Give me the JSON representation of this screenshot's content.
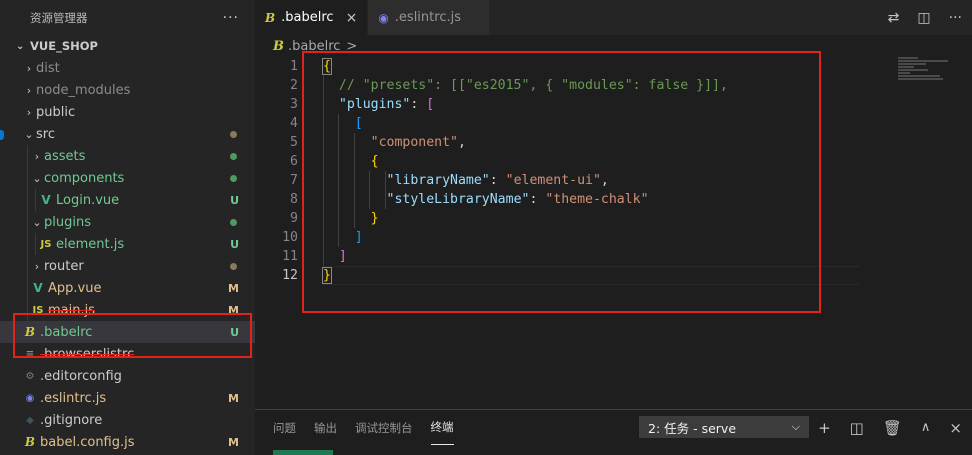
{
  "sidebar": {
    "title": "资源管理器",
    "more_icon": "ellipsis-icon",
    "project": "VUE_SHOP",
    "items": [
      {
        "label": "dist",
        "kind": "folder",
        "expanded": false,
        "depth": 1,
        "color": "#8c8c8c",
        "decoration": ""
      },
      {
        "label": "node_modules",
        "kind": "folder",
        "expanded": false,
        "depth": 1,
        "color": "#8c8c8c",
        "decoration": ""
      },
      {
        "label": "public",
        "kind": "folder",
        "expanded": false,
        "depth": 1,
        "color": "#cccccc",
        "decoration": ""
      },
      {
        "label": "src",
        "kind": "folder",
        "expanded": true,
        "depth": 1,
        "color": "#cccccc",
        "decoration": "dot-gray"
      },
      {
        "label": "assets",
        "kind": "folder",
        "expanded": false,
        "depth": 2,
        "color": "#73c991",
        "decoration": "dot-green"
      },
      {
        "label": "components",
        "kind": "folder",
        "expanded": true,
        "depth": 2,
        "color": "#73c991",
        "decoration": "dot-green"
      },
      {
        "label": "Login.vue",
        "kind": "vue",
        "depth": 3,
        "color": "#73c991",
        "decoration": "U"
      },
      {
        "label": "plugins",
        "kind": "folder",
        "expanded": true,
        "depth": 2,
        "color": "#73c991",
        "decoration": "dot-green"
      },
      {
        "label": "element.js",
        "kind": "js",
        "depth": 3,
        "color": "#73c991",
        "decoration": "U"
      },
      {
        "label": "router",
        "kind": "folder",
        "expanded": false,
        "depth": 2,
        "color": "#cccccc",
        "decoration": "dot-gray"
      },
      {
        "label": "App.vue",
        "kind": "vue",
        "depth": 2,
        "color": "#e2c08d",
        "decoration": "M"
      },
      {
        "label": "main.js",
        "kind": "js",
        "depth": 2,
        "color": "#e2c08d",
        "decoration": "M"
      },
      {
        "label": ".babelrc",
        "kind": "babel",
        "depth": 1,
        "color": "#73c991",
        "decoration": "U"
      },
      {
        "label": ".browserslistrc",
        "kind": "list",
        "depth": 1,
        "color": "#cccccc",
        "decoration": ""
      },
      {
        "label": ".editorconfig",
        "kind": "gear",
        "depth": 1,
        "color": "#cccccc",
        "decoration": ""
      },
      {
        "label": ".eslintrc.js",
        "kind": "eslint",
        "depth": 1,
        "color": "#e2c08d",
        "decoration": "M"
      },
      {
        "label": ".gitignore",
        "kind": "git",
        "depth": 1,
        "color": "#cccccc",
        "decoration": ""
      },
      {
        "label": "babel.config.js",
        "kind": "babel",
        "depth": 1,
        "color": "#e2c08d",
        "decoration": "M"
      }
    ]
  },
  "tabs": [
    {
      "label": ".babelrc",
      "icon": "babel-icon",
      "active": true,
      "close": "×"
    },
    {
      "label": ".eslintrc.js",
      "icon": "eslint-icon",
      "active": false
    }
  ],
  "breadcrumb": {
    "file": ".babelrc",
    "separator": ">"
  },
  "editor": {
    "line_numbers": [
      "1",
      "2",
      "3",
      "4",
      "5",
      "6",
      "7",
      "8",
      "9",
      "10",
      "11",
      "12"
    ],
    "lines": [
      [
        {
          "t": "{",
          "c": "tk-brace"
        }
      ],
      [
        {
          "t": "  // \"presets\": [[\"es2015\", { \"modules\": false }]],",
          "c": "tk-comment"
        }
      ],
      [
        {
          "t": "  ",
          "c": "tk-punc"
        },
        {
          "t": "\"plugins\"",
          "c": "tk-key"
        },
        {
          "t": ": ",
          "c": "tk-punc"
        },
        {
          "t": "[",
          "c": "tk-bracket-p"
        }
      ],
      [
        {
          "t": "    ",
          "c": "tk-punc"
        },
        {
          "t": "[",
          "c": "tk-bracket-b"
        }
      ],
      [
        {
          "t": "      ",
          "c": "tk-punc"
        },
        {
          "t": "\"component\"",
          "c": "tk-str"
        },
        {
          "t": ",",
          "c": "tk-punc"
        }
      ],
      [
        {
          "t": "      ",
          "c": "tk-punc"
        },
        {
          "t": "{",
          "c": "tk-brace"
        }
      ],
      [
        {
          "t": "        ",
          "c": "tk-punc"
        },
        {
          "t": "\"libraryName\"",
          "c": "tk-key"
        },
        {
          "t": ": ",
          "c": "tk-punc"
        },
        {
          "t": "\"element-ui\"",
          "c": "tk-str"
        },
        {
          "t": ",",
          "c": "tk-punc"
        }
      ],
      [
        {
          "t": "        ",
          "c": "tk-punc"
        },
        {
          "t": "\"styleLibraryName\"",
          "c": "tk-key"
        },
        {
          "t": ": ",
          "c": "tk-punc"
        },
        {
          "t": "\"theme-chalk\"",
          "c": "tk-str"
        }
      ],
      [
        {
          "t": "      ",
          "c": "tk-punc"
        },
        {
          "t": "}",
          "c": "tk-brace"
        }
      ],
      [
        {
          "t": "    ",
          "c": "tk-punc"
        },
        {
          "t": "]",
          "c": "tk-bracket-b"
        }
      ],
      [
        {
          "t": "  ",
          "c": "tk-punc"
        },
        {
          "t": "]",
          "c": "tk-bracket-p"
        }
      ],
      [
        {
          "t": "}",
          "c": "tk-brace"
        }
      ]
    ]
  },
  "panel": {
    "tabs": [
      "问题",
      "输出",
      "调试控制台",
      "终端"
    ],
    "active_tab": "终端",
    "task_select": "2: 任务 - serve",
    "actions": [
      "plus-icon",
      "split-icon",
      "trash-icon",
      "chevron-up-icon",
      "close-icon"
    ]
  },
  "colors": {
    "highlight_box": "#e0231b",
    "git_untracked": "#73c991",
    "git_modified": "#e2c08d"
  }
}
